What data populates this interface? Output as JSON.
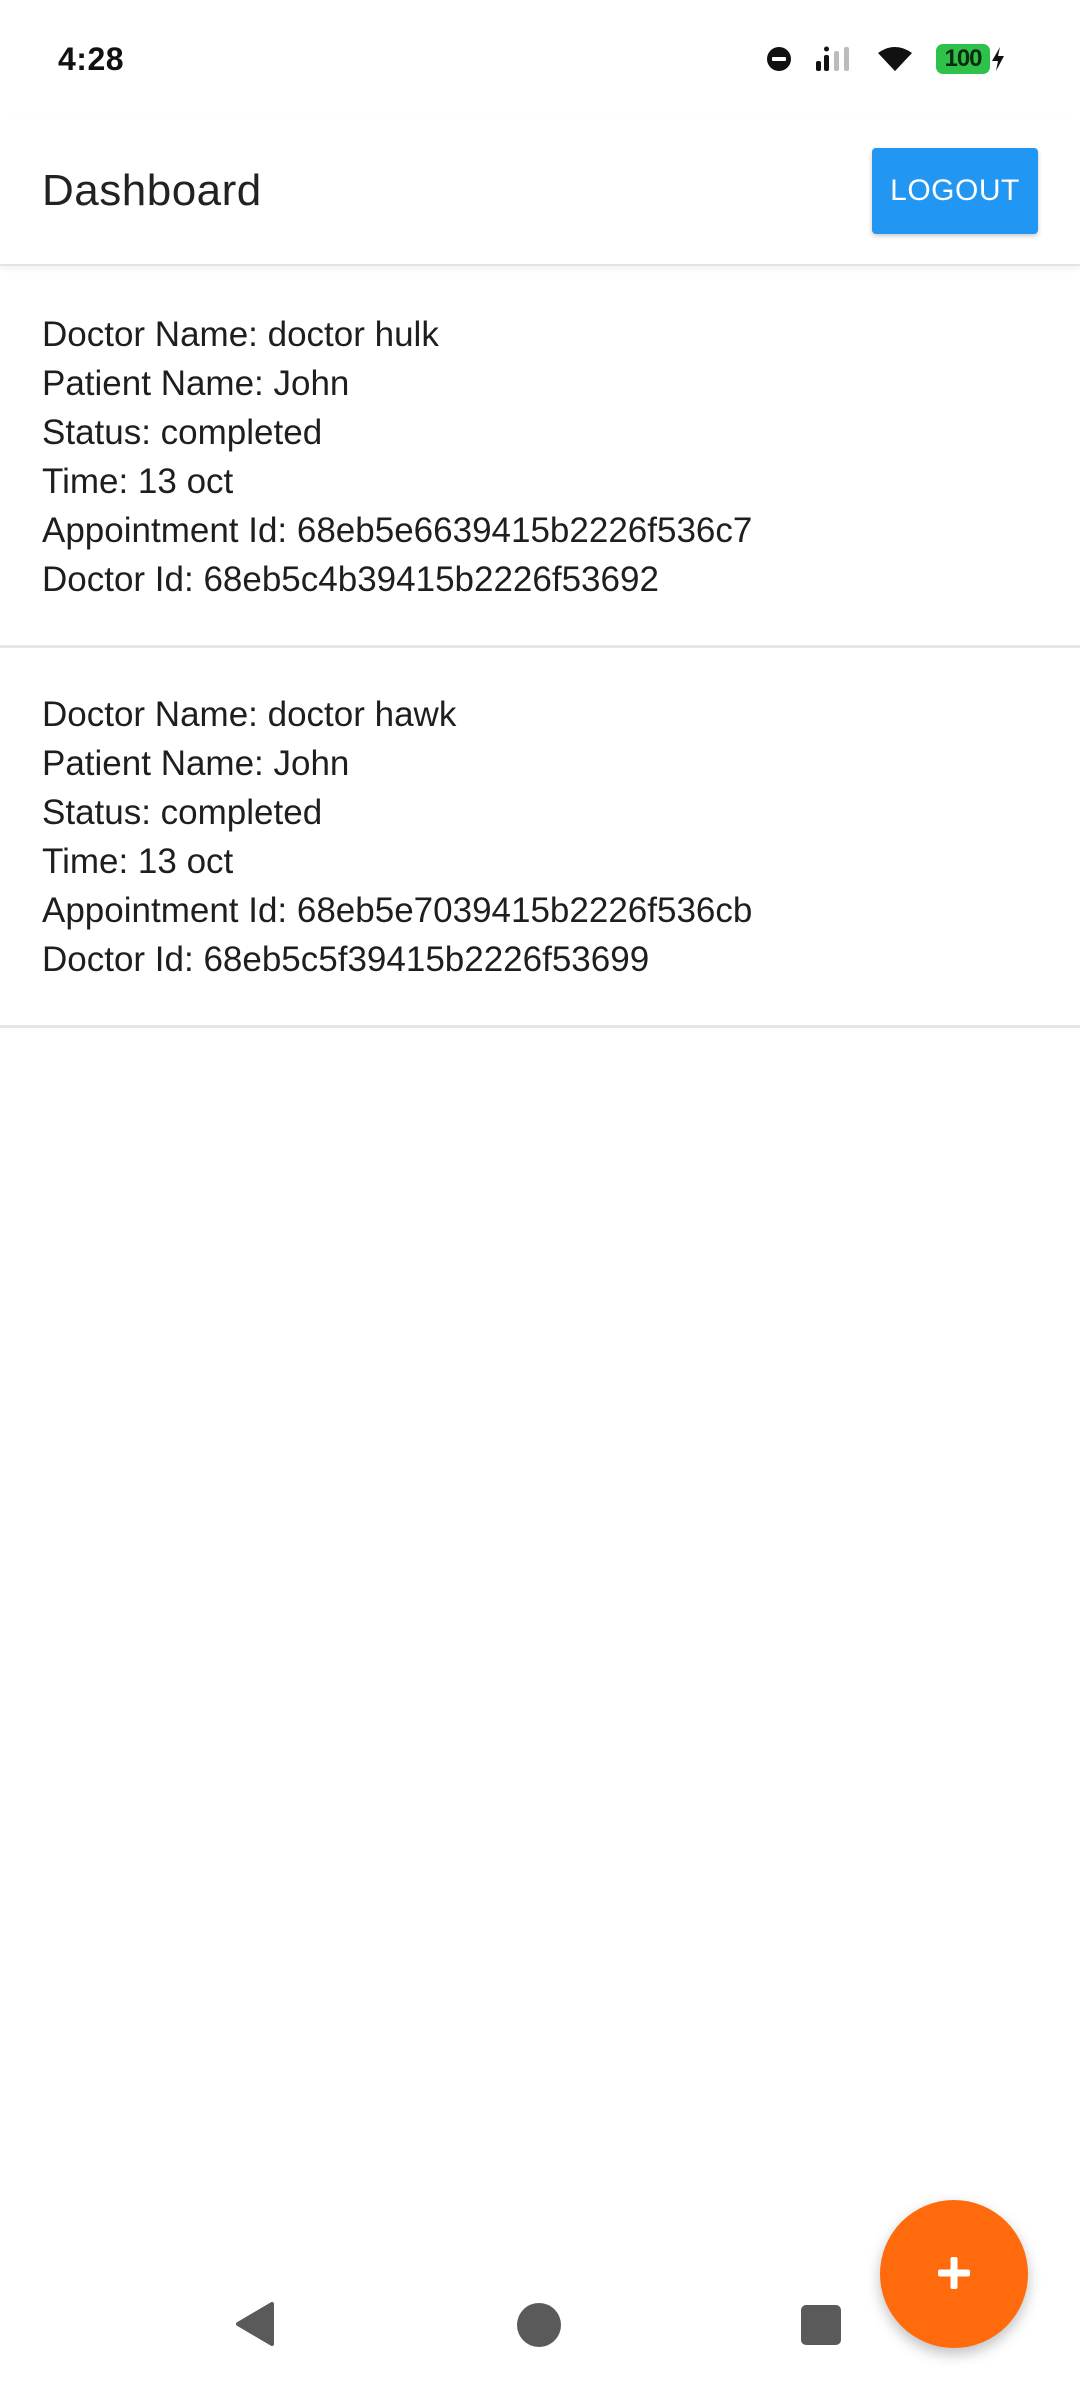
{
  "status_bar": {
    "time": "4:28",
    "battery_level": "100",
    "icons": [
      "dnd-icon",
      "signal-icon",
      "wifi-icon",
      "battery-icon",
      "charging-icon"
    ]
  },
  "app_bar": {
    "title": "Dashboard",
    "logout_label": "LOGOUT",
    "accent_color": "#2196f3"
  },
  "appointments": [
    {
      "doctor_name": "Doctor Name: doctor hulk",
      "patient_name": "Patient Name: John",
      "status": "Status: completed",
      "time": "Time: 13 oct",
      "appointment_id": "Appointment Id: 68eb5e6639415b2226f536c7",
      "doctor_id": "Doctor Id: 68eb5c4b39415b2226f53692"
    },
    {
      "doctor_name": "Doctor Name: doctor hawk",
      "patient_name": "Patient Name: John",
      "status": "Status: completed",
      "time": "Time: 13 oct",
      "appointment_id": "Appointment Id: 68eb5e7039415b2226f536cb",
      "doctor_id": "Doctor Id: 68eb5c5f39415b2226f53699"
    }
  ],
  "fab": {
    "icon": "plus-icon",
    "color": "#ff6a0c"
  },
  "nav_bar": {
    "icons": [
      "back-icon",
      "home-icon",
      "recents-icon"
    ]
  }
}
